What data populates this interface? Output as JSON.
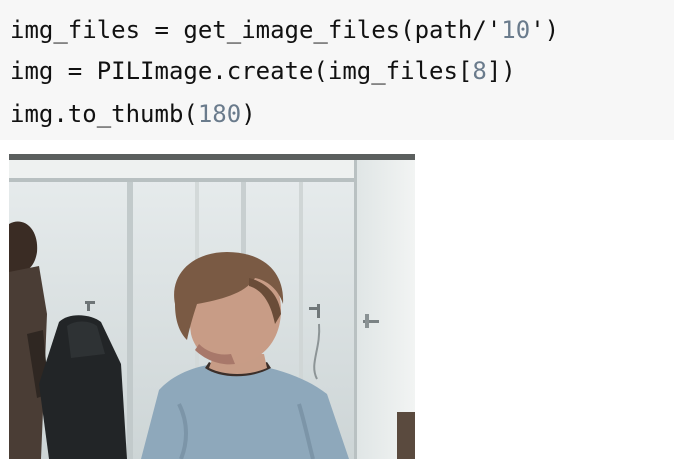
{
  "code": {
    "line1": {
      "before": "img_files = get_image_files(path/'",
      "number": "10",
      "after": "')"
    },
    "line2": {
      "before": "img = PILImage.create(img_files[",
      "number": "8",
      "after": "])"
    },
    "line3": {
      "before": "img.to_thumb(",
      "number": "180",
      "after": ")"
    },
    "number_color": "#6a7b8c"
  },
  "output": {
    "image_subject": "photo-of-person-in-room"
  }
}
